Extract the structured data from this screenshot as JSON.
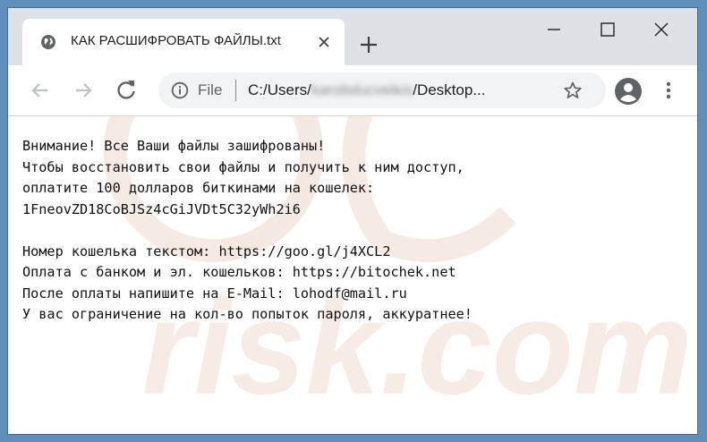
{
  "colors": {
    "titlebar": "#dee1e6",
    "omnibox": "#f1f3f4",
    "desktop_frame": "#5f8fb8",
    "watermark": "#f4e4dc"
  },
  "tab": {
    "title": "КАК РАСШИФРОВАТЬ ФАЙЛЫ.txt",
    "favicon": "globe-icon",
    "close_icon": "close-icon"
  },
  "new_tab_icon": "plus-icon",
  "window_controls": {
    "minimize": "minimize-icon",
    "maximize": "maximize-icon",
    "close": "close-icon"
  },
  "toolbar": {
    "back_icon": "back-arrow-icon",
    "forward_icon": "forward-arrow-icon",
    "reload_icon": "reload-icon",
    "star_icon": "star-icon",
    "account_icon": "account-icon",
    "menu_icon": "kebab-menu-icon"
  },
  "omnibox": {
    "scheme": "File",
    "url_prefix": "C:/Users/",
    "url_hidden": "karolislucveikis",
    "url_suffix": "/Desktop..."
  },
  "document": {
    "lines": [
      "Внимание! Все Ваши файлы зашифрованы!",
      "Чтобы восстановить свои файлы и получить к ним доступ,",
      "оплатите 100 долларов биткинами на кошелек:",
      "1FneovZD18CoBJSz4cGiJVDt5C32yWh2i6",
      "",
      "Номер кошелька текстом: https://goo.gl/j4XCL2",
      "Оплата с банком и эл. кошельков: https://bitochek.net",
      "После оплаты напишите на E-Mail: lohodf@mail.ru",
      "У вас ограничение на кол-во попыток пароля, аккуратнее!"
    ]
  },
  "watermark": {
    "text": "risk.com"
  }
}
